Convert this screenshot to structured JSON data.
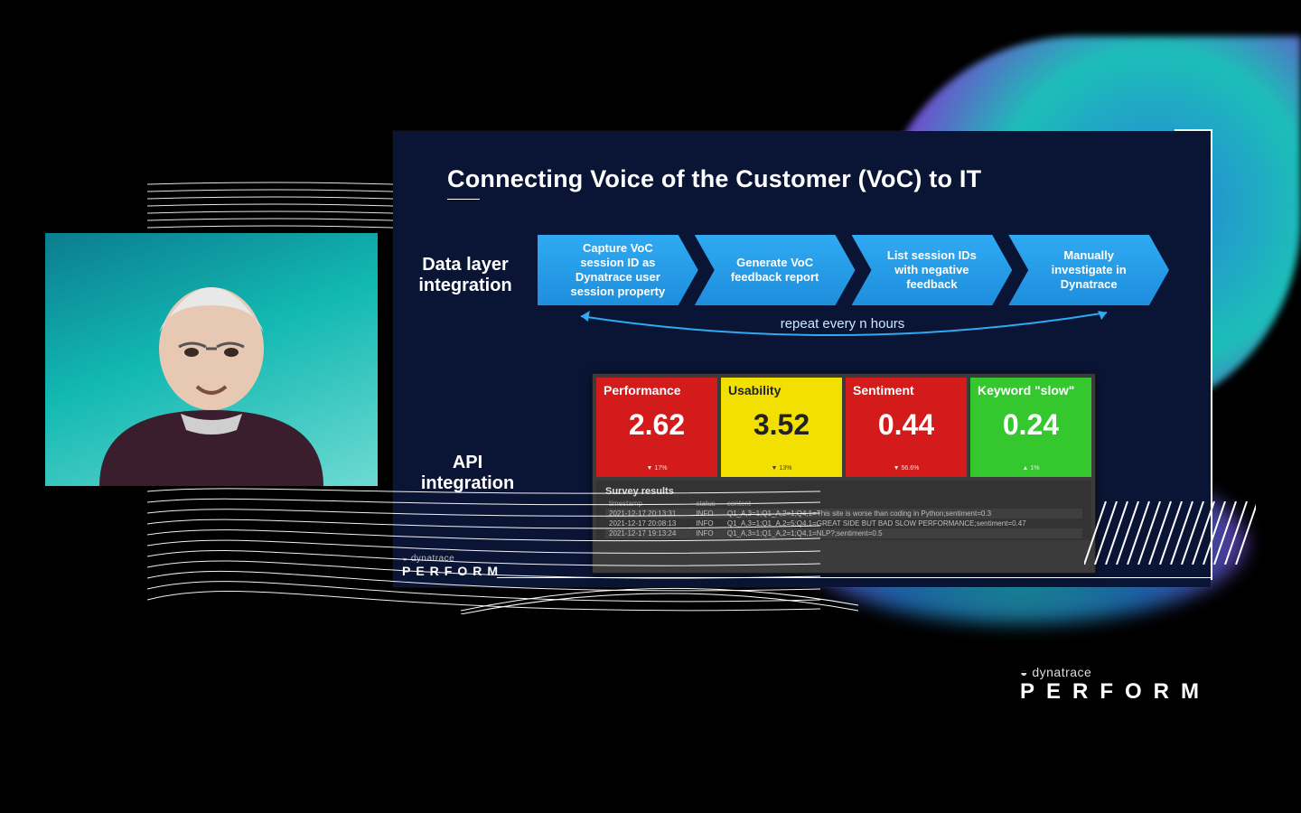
{
  "slide": {
    "title": "Connecting Voice of the Customer (VoC) to IT",
    "labels": {
      "data_layer": "Data layer integration",
      "api": "API integration"
    },
    "flow_steps": [
      "Capture VoC session ID as Dynatrace user session property",
      "Generate VoC feedback report",
      "List session IDs with negative feedback",
      "Manually investigate in Dynatrace"
    ],
    "repeat_caption": "repeat every n hours",
    "tiles": [
      {
        "title": "Performance",
        "value": "2.62",
        "sub": "▼ 17%",
        "color": "red"
      },
      {
        "title": "Usability",
        "value": "3.52",
        "sub": "▼ 13%",
        "color": "yellow"
      },
      {
        "title": "Sentiment",
        "value": "0.44",
        "sub": "▼ 56.6%",
        "color": "red"
      },
      {
        "title": "Keyword \"slow\"",
        "value": "0.24",
        "sub": "▲ 1%",
        "color": "green"
      }
    ],
    "survey": {
      "heading": "Survey results",
      "columns": [
        "timestamp",
        "status",
        "content"
      ],
      "rows": [
        {
          "timestamp": "2021-12-17 20:13:31",
          "status": "INFO",
          "content": "Q1_A,3=1;Q1_A,2=1;Q4,1=This site is worse than coding in Python;sentiment=0.3"
        },
        {
          "timestamp": "2021-12-17 20:08:13",
          "status": "INFO",
          "content": "Q1_A,3=1;Q1_A,2=5;Q4,1=GREAT SIDE BUT BAD SLOW PERFORMANCE;sentiment=0.47"
        },
        {
          "timestamp": "2021-12-17 19:13:24",
          "status": "INFO",
          "content": "Q1_A,3=1;Q1_A,2=1;Q4,1=NLP?;sentiment=0.5"
        }
      ]
    }
  },
  "brand": {
    "name": "dynatrace",
    "event": "PERFORM"
  }
}
